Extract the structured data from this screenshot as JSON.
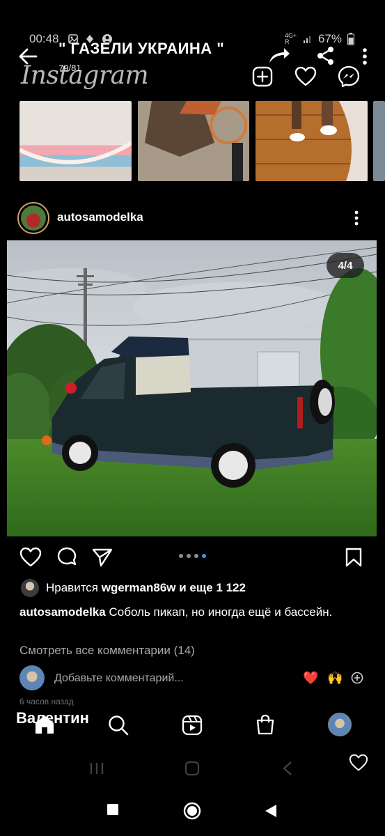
{
  "status": {
    "time": "00:48",
    "network": "4G+ R",
    "battery": "67%"
  },
  "viewer": {
    "title": "\" ГАЗЕЛИ УКРАИНА \"",
    "counter": "79/81"
  },
  "instagram": {
    "logo": "Instagram"
  },
  "post": {
    "username": "autosamodelka",
    "pager": "4/4",
    "likes_prefix": "Нравится",
    "likes_user": "wgerman86w",
    "likes_suffix": "и еще 1 122",
    "caption_user": "autosamodelka",
    "caption_text": "Соболь пикап, но иногда ещё и бассейн.",
    "view_comments": "Смотреть все комментарии (14)",
    "comment_placeholder": "Добавьте комментарий...",
    "time_ago": "6 часов назад"
  },
  "quick_reactions": [
    "❤️",
    "🙌"
  ],
  "overlay_caller": "Валентин",
  "colors": {
    "accent_blue": "#3897f0",
    "heart_red": "#ed4956"
  }
}
